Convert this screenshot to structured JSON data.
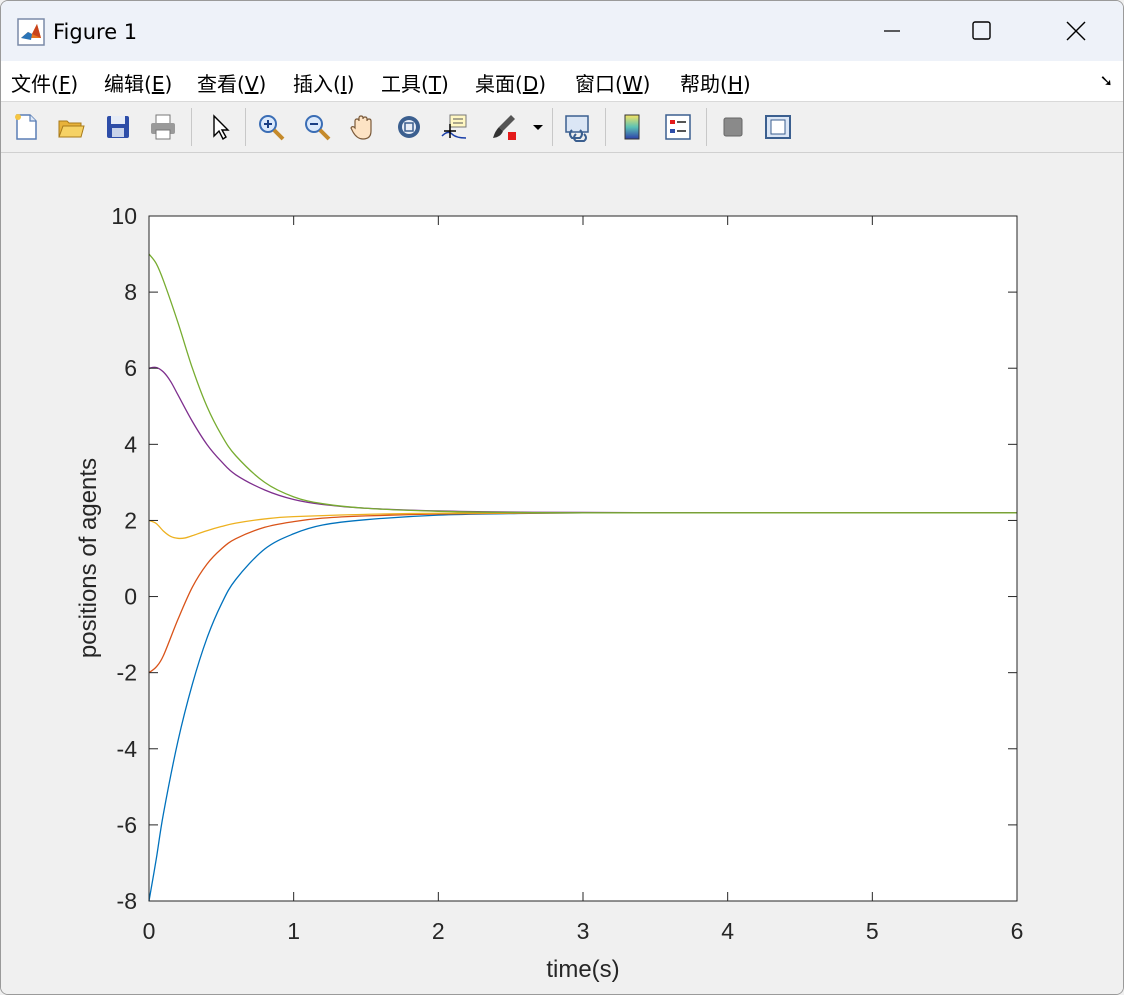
{
  "window": {
    "title": "Figure 1"
  },
  "menu": {
    "items": [
      {
        "pre": "文件(",
        "key": "F",
        "post": ")"
      },
      {
        "pre": "编辑(",
        "key": "E",
        "post": ")"
      },
      {
        "pre": "查看(",
        "key": "V",
        "post": ")"
      },
      {
        "pre": "插入(",
        "key": "I",
        "post": ")"
      },
      {
        "pre": "工具(",
        "key": "T",
        "post": ")"
      },
      {
        "pre": "桌面(",
        "key": "D",
        "post": ")"
      },
      {
        "pre": "窗口(",
        "key": "W",
        "post": ")"
      },
      {
        "pre": "帮助(",
        "key": "H",
        "post": ")"
      }
    ]
  },
  "toolbar": {
    "icons": [
      "new-figure-icon",
      "open-file-icon",
      "save-icon",
      "print-icon",
      "edit-plot-arrow-icon",
      "zoom-in-icon",
      "zoom-out-icon",
      "pan-hand-icon",
      "rotate-3d-icon",
      "data-cursor-icon",
      "brush-icon",
      "brush-dropdown-icon",
      "link-plot-icon",
      "colorbar-icon",
      "legend-icon",
      "hide-plot-tools-icon",
      "show-plot-tools-icon"
    ]
  },
  "chart_data": {
    "type": "line",
    "title": "",
    "xlabel": "time(s)",
    "ylabel": "positions of agents",
    "xlim": [
      0,
      6
    ],
    "ylim": [
      -8,
      10
    ],
    "xticks": [
      "0",
      "1",
      "2",
      "3",
      "4",
      "5",
      "6"
    ],
    "yticks": [
      "-8",
      "-6",
      "-4",
      "-2",
      "0",
      "2",
      "4",
      "6",
      "8",
      "10"
    ],
    "grid": false,
    "legend": "none",
    "series": [
      {
        "color": "#0072bd",
        "x": [
          0,
          0.05,
          0.1,
          0.2,
          0.3,
          0.4,
          0.5,
          0.6,
          0.8,
          1.0,
          1.2,
          1.5,
          2.0,
          2.5,
          3.0,
          4.0,
          5.0,
          6.0
        ],
        "y": [
          -8,
          -6.9,
          -5.7,
          -3.8,
          -2.3,
          -1.1,
          -0.2,
          0.45,
          1.25,
          1.65,
          1.88,
          2.02,
          2.14,
          2.18,
          2.2,
          2.2,
          2.2,
          2.2
        ]
      },
      {
        "color": "#d95319",
        "x": [
          0,
          0.05,
          0.1,
          0.2,
          0.3,
          0.4,
          0.5,
          0.6,
          0.8,
          1.0,
          1.2,
          1.5,
          2.0,
          2.5,
          3.0,
          4.0,
          5.0,
          6.0
        ],
        "y": [
          -2,
          -1.85,
          -1.55,
          -0.6,
          0.25,
          0.85,
          1.25,
          1.52,
          1.82,
          1.97,
          2.06,
          2.12,
          2.17,
          2.19,
          2.2,
          2.2,
          2.2,
          2.2
        ]
      },
      {
        "color": "#edb120",
        "x": [
          0,
          0.05,
          0.1,
          0.15,
          0.2,
          0.25,
          0.3,
          0.4,
          0.5,
          0.6,
          0.8,
          1.0,
          1.5,
          2.0,
          3.0,
          4.0,
          5.0,
          6.0
        ],
        "y": [
          2,
          1.92,
          1.72,
          1.58,
          1.53,
          1.54,
          1.6,
          1.73,
          1.84,
          1.93,
          2.04,
          2.1,
          2.16,
          2.19,
          2.2,
          2.2,
          2.2,
          2.2
        ]
      },
      {
        "color": "#7e2f8e",
        "x": [
          0,
          0.05,
          0.1,
          0.15,
          0.2,
          0.3,
          0.4,
          0.5,
          0.6,
          0.8,
          1.0,
          1.2,
          1.5,
          2.0,
          2.5,
          3.0,
          4.0,
          6.0
        ],
        "y": [
          6,
          6.02,
          5.9,
          5.65,
          5.3,
          4.6,
          4.0,
          3.55,
          3.2,
          2.8,
          2.55,
          2.42,
          2.32,
          2.25,
          2.22,
          2.21,
          2.2,
          2.2
        ]
      },
      {
        "color": "#77ac30",
        "x": [
          0,
          0.05,
          0.1,
          0.2,
          0.3,
          0.4,
          0.5,
          0.6,
          0.8,
          1.0,
          1.2,
          1.5,
          2.0,
          2.5,
          3.0,
          4.0,
          6.0
        ],
        "y": [
          9,
          8.75,
          8.3,
          7.2,
          6.0,
          5.0,
          4.25,
          3.7,
          3.0,
          2.62,
          2.44,
          2.32,
          2.24,
          2.21,
          2.2,
          2.2,
          2.2
        ]
      }
    ]
  }
}
